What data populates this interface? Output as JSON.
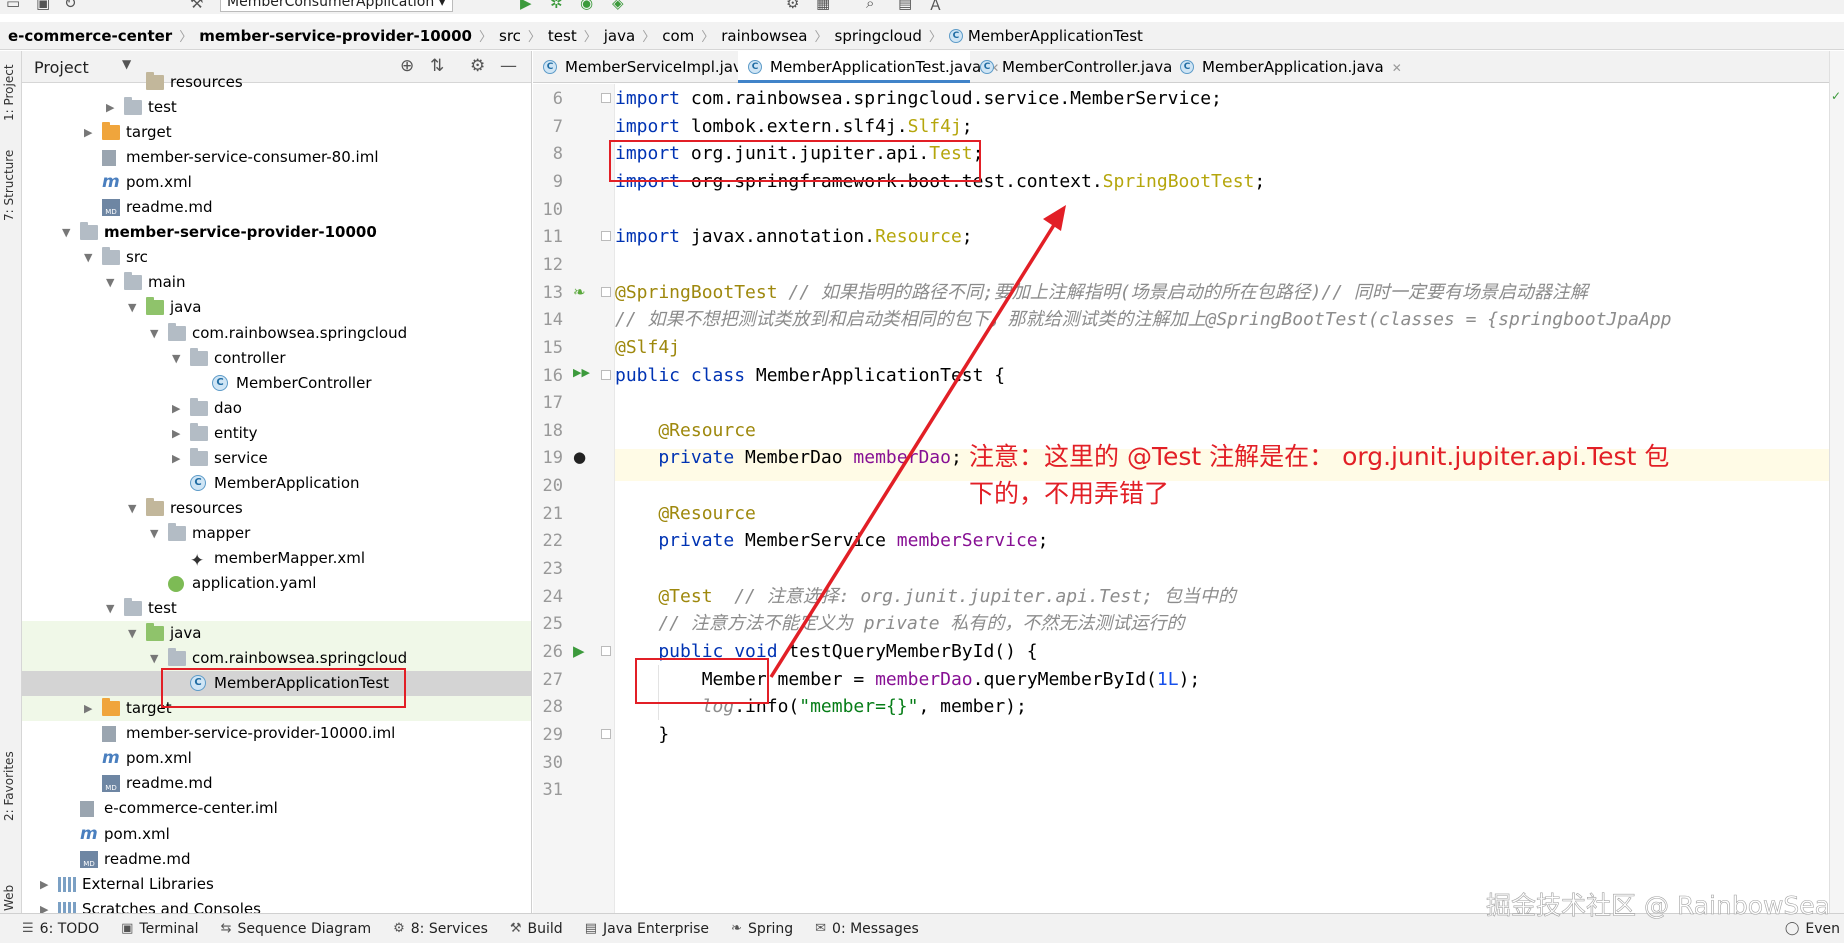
{
  "toolbar": {
    "run_config": "MemberConsumerApplication"
  },
  "breadcrumb": {
    "items": [
      "e-commerce-center",
      "member-service-provider-10000",
      "src",
      "test",
      "java",
      "com",
      "rainbowsea",
      "springcloud",
      "MemberApplicationTest"
    ]
  },
  "stripe": {
    "project": "1: Project",
    "structure": "7: Structure",
    "favorites": "2: Favorites",
    "web": "Web"
  },
  "project_panel": {
    "title": "Project",
    "tree": [
      {
        "label": "resources",
        "icon": "folder-resources-icon",
        "indent": 5
      },
      {
        "label": "test",
        "icon": "folder-icon",
        "indent": 4,
        "arrow": "right"
      },
      {
        "label": "target",
        "icon": "folder-orange-icon",
        "indent": 3,
        "arrow": "right"
      },
      {
        "label": "member-service-consumer-80.iml",
        "icon": "iml-file-icon",
        "indent": 3
      },
      {
        "label": "pom.xml",
        "icon": "maven-icon",
        "indent": 3
      },
      {
        "label": "readme.md",
        "icon": "markdown-icon",
        "indent": 3
      },
      {
        "label": "member-service-provider-10000",
        "icon": "module-folder-icon",
        "indent": 2,
        "arrow": "down",
        "bold": true
      },
      {
        "label": "src",
        "icon": "folder-icon",
        "indent": 3,
        "arrow": "down"
      },
      {
        "label": "main",
        "icon": "folder-icon",
        "indent": 4,
        "arrow": "down"
      },
      {
        "label": "java",
        "icon": "folder-source-icon",
        "indent": 5,
        "arrow": "down"
      },
      {
        "label": "com.rainbowsea.springcloud",
        "icon": "package-icon",
        "indent": 6,
        "arrow": "down"
      },
      {
        "label": "controller",
        "icon": "package-icon",
        "indent": 7,
        "arrow": "down"
      },
      {
        "label": "MemberController",
        "icon": "class-icon",
        "indent": 8
      },
      {
        "label": "dao",
        "icon": "package-icon",
        "indent": 7,
        "arrow": "right"
      },
      {
        "label": "entity",
        "icon": "package-icon",
        "indent": 7,
        "arrow": "right"
      },
      {
        "label": "service",
        "icon": "package-icon",
        "indent": 7,
        "arrow": "right"
      },
      {
        "label": "MemberApplication",
        "icon": "spring-class-icon",
        "indent": 7
      },
      {
        "label": "resources",
        "icon": "folder-resources-icon",
        "indent": 5,
        "arrow": "down"
      },
      {
        "label": "mapper",
        "icon": "folder-icon",
        "indent": 6,
        "arrow": "down"
      },
      {
        "label": "memberMapper.xml",
        "icon": "mybatis-xml-icon",
        "indent": 7
      },
      {
        "label": "application.yaml",
        "icon": "yaml-icon",
        "indent": 6
      },
      {
        "label": "test",
        "icon": "folder-icon",
        "indent": 4,
        "arrow": "down"
      },
      {
        "label": "java",
        "icon": "folder-test-icon",
        "indent": 5,
        "arrow": "down",
        "green": true
      },
      {
        "label": "com.rainbowsea.springcloud",
        "icon": "package-icon",
        "indent": 6,
        "arrow": "down",
        "green": true
      },
      {
        "label": "MemberApplicationTest",
        "icon": "spring-class-icon",
        "indent": 7,
        "selected": true
      },
      {
        "label": "target",
        "icon": "folder-orange-icon",
        "indent": 3,
        "arrow": "right",
        "green": true
      },
      {
        "label": "member-service-provider-10000.iml",
        "icon": "iml-file-icon",
        "indent": 3
      },
      {
        "label": "pom.xml",
        "icon": "maven-icon",
        "indent": 3
      },
      {
        "label": "readme.md",
        "icon": "markdown-icon",
        "indent": 3
      },
      {
        "label": "e-commerce-center.iml",
        "icon": "iml-file-icon",
        "indent": 2
      },
      {
        "label": "pom.xml",
        "icon": "maven-icon",
        "indent": 2
      },
      {
        "label": "readme.md",
        "icon": "markdown-icon",
        "indent": 2
      },
      {
        "label": "External Libraries",
        "icon": "libraries-icon",
        "indent": 1,
        "arrow": "right"
      },
      {
        "label": "Scratches and Consoles",
        "icon": "scratches-icon",
        "indent": 1,
        "arrow": "right"
      }
    ]
  },
  "tabs": [
    {
      "label": "MemberServiceImpl.java",
      "active": false
    },
    {
      "label": "MemberApplicationTest.java",
      "active": true
    },
    {
      "label": "MemberController.java",
      "active": false
    },
    {
      "label": "MemberApplication.java",
      "active": false
    }
  ],
  "code": {
    "line_numbers": [
      "6",
      "7",
      "8",
      "9",
      "10",
      "11",
      "12",
      "13",
      "14",
      "15",
      "16",
      "17",
      "18",
      "19",
      "20",
      "21",
      "22",
      "23",
      "24",
      "25",
      "26",
      "27",
      "28",
      "29",
      "30",
      "31"
    ],
    "lines": [
      [
        [
          "kw",
          "import "
        ],
        [
          "type",
          "com.rainbowsea.springcloud.service.MemberService;"
        ]
      ],
      [
        [
          "kw",
          "import "
        ],
        [
          "type",
          "lombok.extern.slf4j."
        ],
        [
          "grey",
          "Slf4j"
        ],
        [
          "type",
          ";"
        ]
      ],
      [
        [
          "kw",
          "import "
        ],
        [
          "type",
          "org.junit.jupiter.api."
        ],
        [
          "grey",
          "Test"
        ],
        [
          "type",
          ";"
        ]
      ],
      [
        [
          "kw",
          "import "
        ],
        [
          "type",
          "org.springframework.boot.test.context."
        ],
        [
          "grey",
          "SpringBootTest"
        ],
        [
          "type",
          ";"
        ]
      ],
      [],
      [
        [
          "kw",
          "import "
        ],
        [
          "type",
          "javax.annotation."
        ],
        [
          "grey",
          "Resource"
        ],
        [
          "type",
          ";"
        ]
      ],
      [],
      [
        [
          "ann",
          "@SpringBootTest "
        ],
        [
          "cmt",
          "// 如果指明的路径不同;要加上注解指明(场景启动的所在包路径)// 同时一定要有场景启动器注解"
        ]
      ],
      [
        [
          "cmt",
          "// 如果不想把测试类放到和启动类相同的包下，那就给测试类的注解加上@SpringBootTest(classes = {springbootJpaApp"
        ]
      ],
      [
        [
          "ann",
          "@Slf4j"
        ]
      ],
      [
        [
          "kw",
          "public class "
        ],
        [
          "type",
          "MemberApplicationTest {"
        ]
      ],
      [],
      [
        [
          "ann",
          "    @Resource"
        ]
      ],
      [
        [
          "kw",
          "    private "
        ],
        [
          "type",
          "MemberDao "
        ],
        [
          "fld",
          "memberDao"
        ],
        [
          "type",
          ";"
        ]
      ],
      [],
      [
        [
          "ann",
          "    @Resource"
        ]
      ],
      [
        [
          "kw",
          "    private "
        ],
        [
          "type",
          "MemberService "
        ],
        [
          "fld",
          "memberService"
        ],
        [
          "type",
          ";"
        ]
      ],
      [],
      [
        [
          "ann",
          "    @Test  "
        ],
        [
          "cmt",
          "// 注意选择: org.junit.jupiter.api.Test; 包当中的"
        ]
      ],
      [
        [
          "cmt",
          "    // 注意方法不能定义为 private 私有的，不然无法测试运行的"
        ]
      ],
      [
        [
          "kw",
          "    public void "
        ],
        [
          "type",
          "testQueryMemberById() {"
        ]
      ],
      [
        [
          "type",
          "        Member member = "
        ],
        [
          "fld",
          "memberDao"
        ],
        [
          "type",
          ".queryMemberById("
        ],
        [
          "num",
          "1L"
        ],
        [
          "type",
          ");"
        ]
      ],
      [
        [
          "cmt",
          "        log"
        ],
        [
          "type",
          ".info("
        ],
        [
          "str",
          "\"member={}\""
        ],
        [
          "type",
          ", member);"
        ]
      ],
      [
        [
          "type",
          "    }"
        ]
      ],
      [],
      []
    ]
  },
  "annotation_note": {
    "line1": "注意：这里的 @Test 注解是在： org.junit.jupiter.api.Test 包",
    "line2": "下的，不用弄错了"
  },
  "bottom_bar": {
    "items": [
      {
        "label": "6: TODO",
        "icon": "todo-icon"
      },
      {
        "label": "Terminal",
        "icon": "terminal-icon"
      },
      {
        "label": "Sequence Diagram",
        "icon": "sequence-diagram-icon"
      },
      {
        "label": "8: Services",
        "icon": "services-icon"
      },
      {
        "label": "Build",
        "icon": "build-icon"
      },
      {
        "label": "Java Enterprise",
        "icon": "java-enterprise-icon"
      },
      {
        "label": "Spring",
        "icon": "spring-icon"
      },
      {
        "label": "0: Messages",
        "icon": "messages-icon"
      }
    ],
    "event_log": "Even"
  },
  "watermark": "掘金技术社区 @ RainbowSea",
  "colors": {
    "accent": "#4083c9",
    "annotation_red": "#e21f26"
  }
}
